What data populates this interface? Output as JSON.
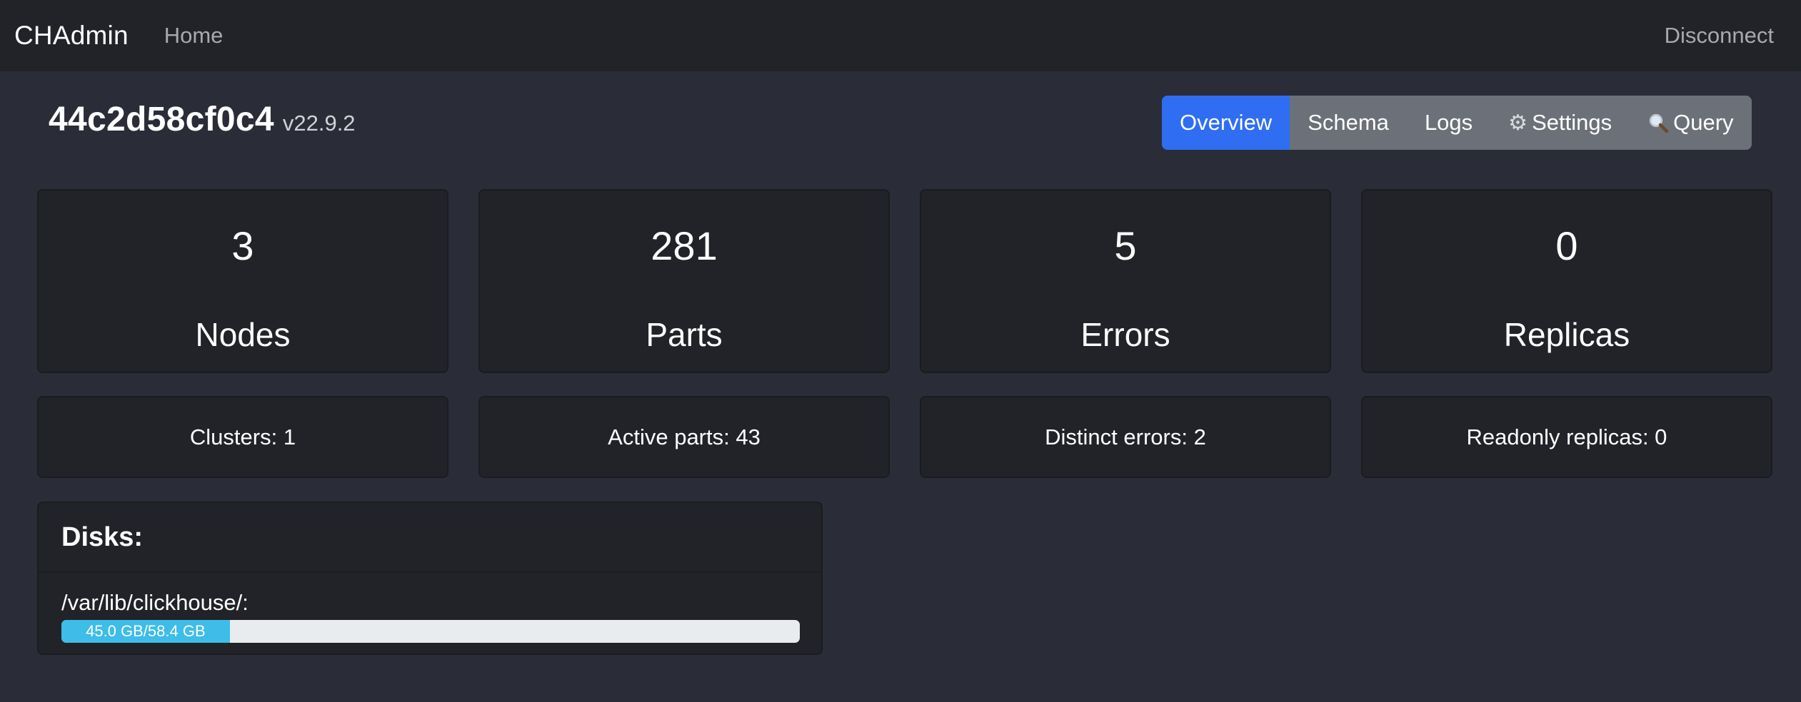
{
  "navbar": {
    "brand": "CHAdmin",
    "home_link": "Home",
    "disconnect_link": "Disconnect"
  },
  "header": {
    "host_name": "44c2d58cf0c4",
    "version": "v22.9.2"
  },
  "tabs": [
    {
      "label": "Overview",
      "icon": "",
      "active": true
    },
    {
      "label": "Schema",
      "icon": "",
      "active": false
    },
    {
      "label": "Logs",
      "icon": "",
      "active": false
    },
    {
      "label": "Settings",
      "icon": "gear-icon",
      "active": false
    },
    {
      "label": "Query",
      "icon": "magnifier-icon",
      "active": false
    }
  ],
  "stats": [
    {
      "value": "3",
      "label": "Nodes"
    },
    {
      "value": "281",
      "label": "Parts"
    },
    {
      "value": "5",
      "label": "Errors"
    },
    {
      "value": "0",
      "label": "Replicas"
    }
  ],
  "sub_stats": [
    {
      "text": "Clusters: 1"
    },
    {
      "text": "Active parts: 43"
    },
    {
      "text": "Distinct errors: 2"
    },
    {
      "text": "Readonly replicas: 0"
    }
  ],
  "disks": {
    "title": "Disks:",
    "items": [
      {
        "path": "/var/lib/clickhouse/:",
        "usage_label": "45.0 GB/58.4 GB",
        "used_fraction": 0.228
      }
    ]
  },
  "colors": {
    "background": "#2a2d37",
    "navbar": "#212328",
    "card": "#212328",
    "active_tab": "#2f6ef2",
    "tab_group": "#6c7078",
    "progress_fill": "#3dbde8",
    "progress_track": "#e9ecef"
  }
}
